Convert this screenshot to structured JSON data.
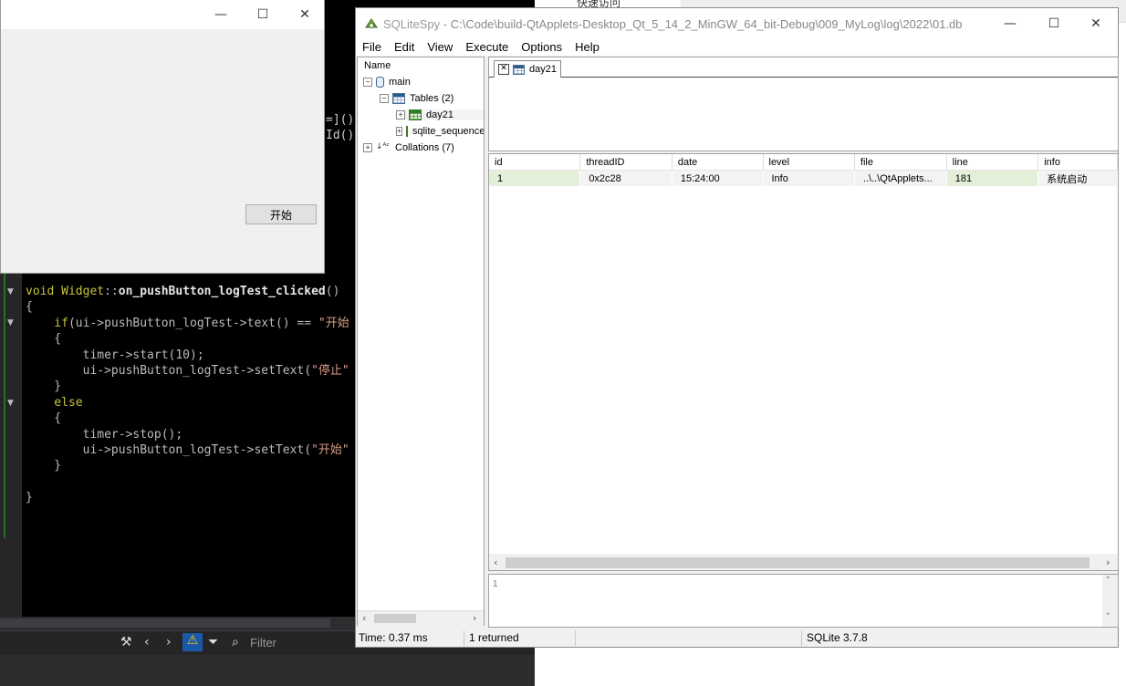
{
  "editor": {
    "code_lines": [
      {
        "parts": [
          {
            "t": "void ",
            "c": "kw"
          },
          {
            "t": "Widget",
            "c": "kw"
          },
          {
            "t": "::",
            "c": "br"
          },
          {
            "t": "on_pushButton_logTest_clicked",
            "c": "fn"
          },
          {
            "t": "()",
            "c": "br"
          }
        ]
      },
      {
        "parts": [
          {
            "t": "{",
            "c": "br"
          }
        ]
      },
      {
        "parts": [
          {
            "t": "    if",
            "c": "kw"
          },
          {
            "t": "(ui->pushButton_logTest->text() == ",
            "c": "br"
          },
          {
            "t": "\"开始",
            "c": "str"
          }
        ]
      },
      {
        "parts": [
          {
            "t": "    {",
            "c": "br"
          }
        ]
      },
      {
        "parts": [
          {
            "t": "        timer->start(10);",
            "c": "br"
          }
        ]
      },
      {
        "parts": [
          {
            "t": "        ui->pushButton_logTest->setText(",
            "c": "br"
          },
          {
            "t": "\"停止\"",
            "c": "str"
          }
        ]
      },
      {
        "parts": [
          {
            "t": "    }",
            "c": "br"
          }
        ]
      },
      {
        "parts": [
          {
            "t": "    else",
            "c": "kw"
          }
        ]
      },
      {
        "parts": [
          {
            "t": "    {",
            "c": "br"
          }
        ]
      },
      {
        "parts": [
          {
            "t": "        timer->stop();",
            "c": "br"
          }
        ]
      },
      {
        "parts": [
          {
            "t": "        ui->pushButton_logTest->setText(",
            "c": "br"
          },
          {
            "t": "\"开始\"",
            "c": "str"
          }
        ]
      },
      {
        "parts": [
          {
            "t": "    }",
            "c": "br"
          }
        ]
      },
      {
        "parts": [
          {
            "t": "",
            "c": "br"
          }
        ]
      },
      {
        "parts": [
          {
            "t": "}",
            "c": "br"
          }
        ]
      }
    ],
    "peek1": "=]()",
    "peek2": "Id()",
    "filter_placeholder": "Filter"
  },
  "explorer": {
    "quick_access": "快速访问"
  },
  "widget": {
    "minimize": "—",
    "maximize": "☐",
    "close": "✕",
    "start_button": "开始"
  },
  "sqlitespy": {
    "title_app": "SQLiteSpy",
    "title_path": "C:\\Code\\build-QtApplets-Desktop_Qt_5_14_2_MinGW_64_bit-Debug\\009_MyLog\\log\\2022\\01.db",
    "menu": [
      "File",
      "Edit",
      "View",
      "Execute",
      "Options",
      "Help"
    ],
    "tree": {
      "header": "Name",
      "main": "main",
      "tables": "Tables (2)",
      "table1": "day21",
      "table2": "sqlite_sequence",
      "collations": "Collations (7)"
    },
    "query_tab": "day21",
    "columns": [
      "id",
      "threadID",
      "date",
      "level",
      "file",
      "line",
      "info"
    ],
    "rows": [
      [
        "1",
        "0x2c28",
        "15:24:00",
        "Info",
        "..\\..\\QtApplets...",
        "181",
        "系统启动"
      ]
    ],
    "log_line": "1",
    "status": {
      "time": "Time: 0.37 ms",
      "returned": "1 returned",
      "version": "SQLite 3.7.8"
    }
  },
  "colors": {
    "accent_green": "#e3efd9",
    "editor_bg": "#000000"
  }
}
